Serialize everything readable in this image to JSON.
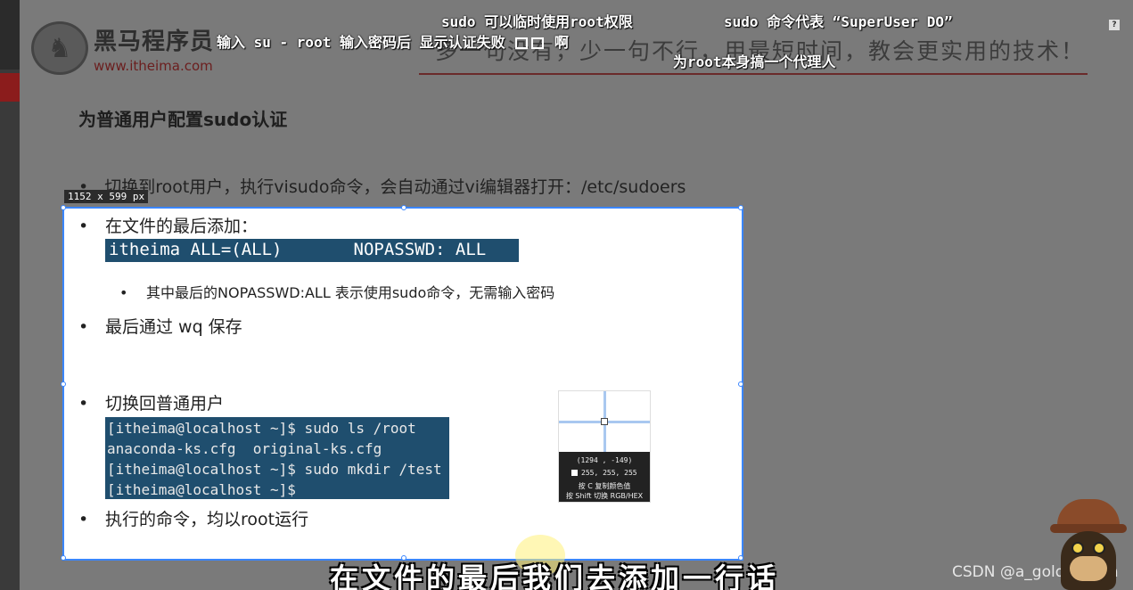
{
  "slide": {
    "logo_name": "黑马程序员",
    "logo_url": "www.itheima.com",
    "slogan": "多一句没有，少一句不行，用最短时间，教会更实用的技术！",
    "title": "为普通用户配置sudo认证",
    "bullet_top": "切换到root用户，执行visudo命令，会自动通过vi编辑器打开：/etc/sudoers"
  },
  "annotations": {
    "line1": "sudo 可以临时使用root权限",
    "line2": "sudo 命令代表 “SuperUser DO”",
    "line3_a": "输入 su - root 输入密码后 显示认证失败",
    "line3_b": "啊",
    "line4": "为root本身搞一个代理人"
  },
  "capture_tool": {
    "dimensions_label": "1152 x 599  px",
    "picker": {
      "coords": "(1294 , -149)",
      "rgb": "255, 255, 255",
      "tip_copy": "按 C 复制颜色值",
      "tip_switch": "按 Shift 切换 RGB/HEX"
    }
  },
  "content": {
    "bullet_add": "在文件的最后添加：",
    "code_line": "itheima ALL=(ALL)       NOPASSWD: ALL",
    "sub_note": "其中最后的NOPASSWD:ALL 表示使用sudo命令，无需输入密码",
    "bullet_save": "最后通过 wq 保存",
    "bullet_switch": "切换回普通用户",
    "terminal": [
      "[itheima@localhost ~]$ sudo ls /root",
      "anaconda-ks.cfg  original-ks.cfg",
      "[itheima@localhost ~]$ sudo mkdir /test",
      "[itheima@localhost ~]$"
    ],
    "bullet_root": "执行的命令，均以root运行"
  },
  "video": {
    "subtitle": "在文件的最后我们去添加一行话",
    "watermark": "CSDN @a_golden_fish"
  },
  "colors": {
    "selection_border": "#3a86ff",
    "code_bg": "#1f4e6e",
    "brand_red": "#8b1c1c"
  }
}
